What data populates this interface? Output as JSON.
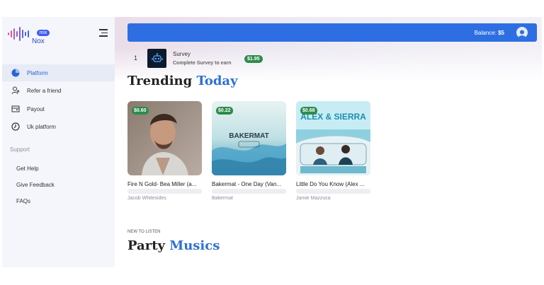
{
  "app": {
    "logo_badge": "mix",
    "logo_name": "Nox"
  },
  "sidebar": {
    "items": [
      {
        "label": "Platform",
        "icon": "pie-chart-icon",
        "active": true
      },
      {
        "label": "Refer a friend",
        "icon": "add-user-icon"
      },
      {
        "label": "Payout",
        "icon": "wallet-icon"
      },
      {
        "label": "Uk platform",
        "icon": "clock-icon"
      }
    ],
    "support_label": "Support",
    "support_items": [
      "Get Help",
      "Give Feedback",
      "FAQs"
    ]
  },
  "header": {
    "balance_label": "Balance:",
    "balance_value": "$5"
  },
  "survey": {
    "rank": "1",
    "title": "Survey",
    "subtitle": "Complete Survey to earn",
    "reward": "$1.95"
  },
  "trending": {
    "title_main": "Trending",
    "title_accent": "Today",
    "cards": [
      {
        "price": "$0.60",
        "title": "Fire N Gold- Bea Miller (a...",
        "artist": "Jacob Whitesides"
      },
      {
        "price": "$0.22",
        "title": "Bakermat - One Day (Van...",
        "artist": "Bakermat",
        "art_text": "BAKERMAT"
      },
      {
        "price": "$0.68",
        "title": "Little Do You Know (Alex ...",
        "artist": "Jamie Mazzuca",
        "art_text": "ALEX & SIERRA"
      }
    ]
  },
  "party": {
    "kicker": "NEW TO LISTEN",
    "title_main": "Party",
    "title_accent": "Musics"
  },
  "colors": {
    "brand_blue": "#2d6fe3",
    "accent_blue": "#2f6fd6",
    "reward_green": "#2e8b4b",
    "sidebar_bg": "#f4f6fb"
  }
}
